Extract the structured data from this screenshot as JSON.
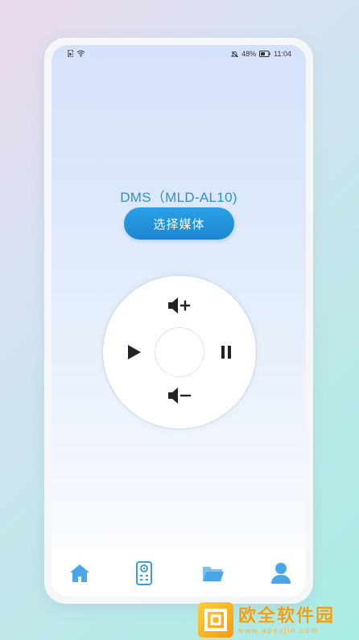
{
  "status_bar": {
    "battery": "48%",
    "time": "11:04"
  },
  "device": {
    "name": "DMS（MLD-AL10)"
  },
  "actions": {
    "select_media_label": "选择媒体"
  },
  "controls": {
    "volume_up": "volume-up-icon",
    "volume_down": "volume-down-icon",
    "play": "play-icon",
    "pause": "pause-icon"
  },
  "tabs": [
    {
      "icon": "home-icon",
      "active": false
    },
    {
      "icon": "remote-icon",
      "active": true
    },
    {
      "icon": "folder-icon",
      "active": false
    },
    {
      "icon": "user-icon",
      "active": false
    }
  ],
  "colors": {
    "accent": "#2d8fd6",
    "tab_icon": "#4aa6e6"
  },
  "watermark": {
    "title": "欧全软件园",
    "url": "www.apoujin.com"
  }
}
